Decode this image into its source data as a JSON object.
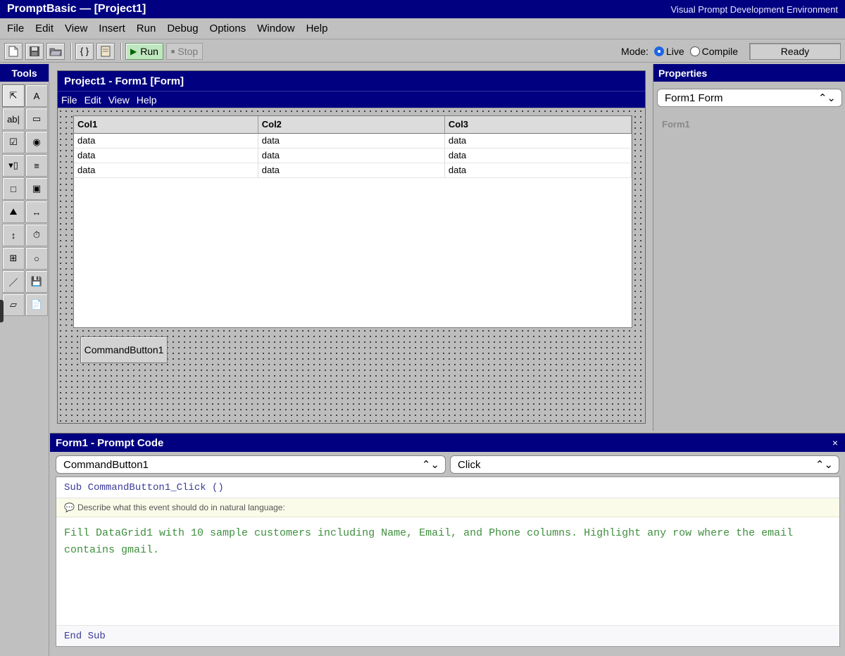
{
  "app": {
    "title": "PromptBasic — [Project1]",
    "subtitle": "Visual Prompt Development Environment"
  },
  "menu": [
    "File",
    "Edit",
    "View",
    "Insert",
    "Run",
    "Debug",
    "Options",
    "Window",
    "Help"
  ],
  "toolbar": {
    "run_label": "Run",
    "stop_label": "Stop",
    "braces_label": "{ }",
    "mode_label": "Mode:",
    "mode_live": "Live",
    "mode_compile": "Compile",
    "mode_selected": "Live",
    "status": "Ready"
  },
  "tools": {
    "title": "Tools",
    "items": [
      {
        "name": "pointer-icon",
        "glyph": "⇱"
      },
      {
        "name": "label-icon",
        "glyph": "A"
      },
      {
        "name": "textbox-icon",
        "glyph": "ab|"
      },
      {
        "name": "frame-icon",
        "glyph": "▭"
      },
      {
        "name": "checkbox-icon",
        "glyph": "☑"
      },
      {
        "name": "option-button-icon",
        "glyph": "◉"
      },
      {
        "name": "combobox-icon",
        "glyph": "▾▯"
      },
      {
        "name": "listbox-icon",
        "glyph": "≡"
      },
      {
        "name": "shape-icon",
        "glyph": "□"
      },
      {
        "name": "image-icon",
        "glyph": "▣"
      },
      {
        "name": "picture-icon",
        "glyph": "⛰"
      },
      {
        "name": "hscroll-icon",
        "glyph": "↔"
      },
      {
        "name": "vscroll-icon",
        "glyph": "↕"
      },
      {
        "name": "timer-icon",
        "glyph": "⏱"
      },
      {
        "name": "grid-icon",
        "glyph": "⊞"
      },
      {
        "name": "circle-icon",
        "glyph": "○"
      },
      {
        "name": "line-icon",
        "glyph": "／"
      },
      {
        "name": "save-icon",
        "glyph": "💾"
      },
      {
        "name": "folder-icon",
        "glyph": "▱"
      },
      {
        "name": "document-icon",
        "glyph": "📄"
      }
    ]
  },
  "designer": {
    "caption": "Project1 - Form1 [Form]",
    "menu": [
      "File",
      "Edit",
      "View",
      "Help"
    ],
    "grid": {
      "columns": [
        "Col1",
        "Col2",
        "Col3"
      ],
      "rows": [
        [
          "data",
          "data",
          "data"
        ],
        [
          "data",
          "data",
          "data"
        ],
        [
          "data",
          "data",
          "data"
        ]
      ]
    },
    "button_label": "CommandButton1"
  },
  "properties": {
    "title": "Properties",
    "selected": "Form1 Form",
    "object_name": "Form1"
  },
  "code": {
    "caption": "Form1 - Prompt Code",
    "close": "×",
    "object": "CommandButton1",
    "event": "Click",
    "sub_line": "Sub CommandButton1_Click ()",
    "hint": "Describe what this event should do in natural language:",
    "prompt": "Fill DataGrid1 with 10 sample customers including Name, Email, and Phone columns. Highlight any row where the email contains gmail.",
    "end_line": "End Sub"
  }
}
